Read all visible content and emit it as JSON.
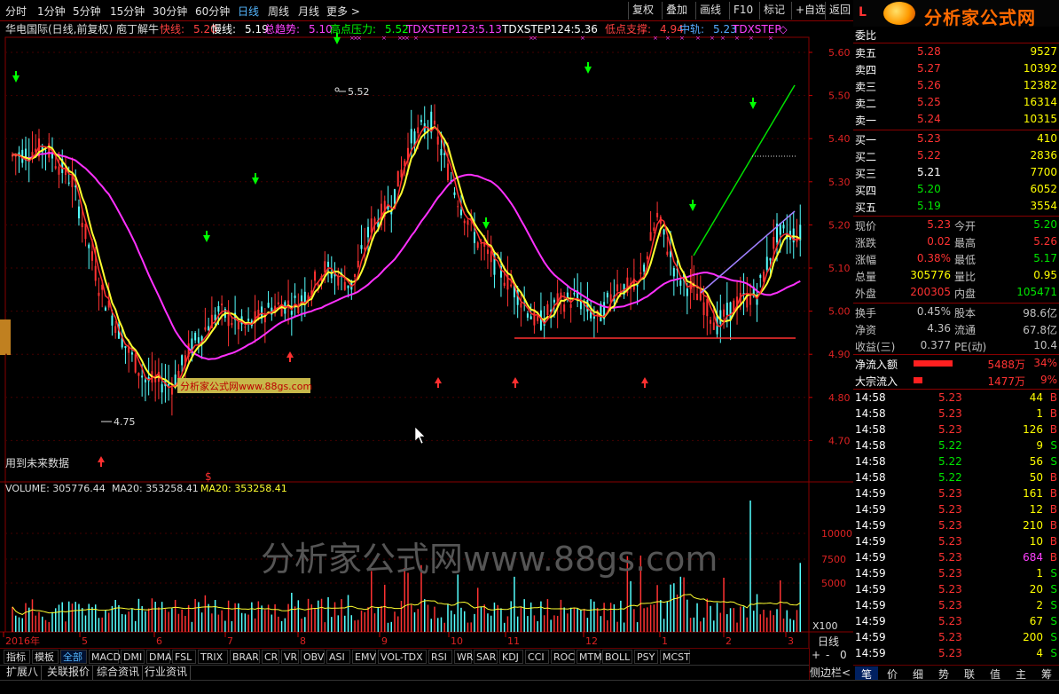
{
  "toolbar": {
    "timeframes": [
      "分时",
      "1分钟",
      "5分钟",
      "15分钟",
      "30分钟",
      "60分钟",
      "日线",
      "周线",
      "月线",
      "更多 >"
    ],
    "active_index": 6,
    "right_buttons": [
      "复权",
      "叠加",
      "画线",
      "F10",
      "标记",
      "+自选",
      "返回"
    ]
  },
  "logo": {
    "letter": "L",
    "name": "分析家公式网",
    "url": "www.88gs.com"
  },
  "chart": {
    "header_title": "华电国际(日线,前复权) 庖丁解牛",
    "indicators": [
      {
        "label": "快线:",
        "value": "5.20",
        "color": "#ff4040"
      },
      {
        "label": "慢线:",
        "value": "5.19",
        "color": "#ffffff"
      },
      {
        "label": "总趋势:",
        "value": "5.10",
        "color": "#ff40ff"
      },
      {
        "label": "高点压力:",
        "value": "5.52",
        "color": "#00ff00"
      },
      {
        "label": "TDXSTEP123:",
        "value": "5.13",
        "color": "#ff40ff"
      },
      {
        "label": "TDXSTEP124:",
        "value": "5.36",
        "color": "#ffffff"
      },
      {
        "label": "低点支撑:",
        "value": "4.94",
        "color": "#ff4040"
      },
      {
        "label": "中轨:",
        "value": "5.23",
        "color": "#55aaff"
      },
      {
        "label": "TDXSTEP",
        "value": "◇",
        "color": "#ff40ff"
      }
    ],
    "price_ticks": [
      "5.60",
      "5.50",
      "5.40",
      "5.30",
      "5.20",
      "5.10",
      "5.00",
      "4.90",
      "4.80",
      "4.70"
    ],
    "high_label": "5.52",
    "low_label": "4.75",
    "future_note": "用到未来数据",
    "watermark_small": "分析家公式网www.88gs.com",
    "volume_header": {
      "vol": "VOLUME: 305776.44",
      "ma1": "MA20: 353258.41",
      "ma2": "MA20: 353258.41"
    },
    "volume_ticks": [
      "10000",
      "7500",
      "5000"
    ],
    "volume_unit": "X100",
    "watermark_big": "分析家公式网www.88gs.com",
    "x_labels": [
      "2016年",
      "5",
      "6",
      "7",
      "8",
      "9",
      "10",
      "11",
      "12",
      "1",
      "2",
      "3"
    ],
    "period_label": "日线",
    "dollar_mark": "$"
  },
  "bottom_tabs": [
    "指标",
    "模板",
    "全部",
    "MACD",
    "DMI",
    "DMA",
    "FSL",
    "TRIX",
    "BRAR",
    "CR",
    "VR",
    "OBV",
    "ASI",
    "EMV",
    "VOL-TDX",
    "RSI",
    "WR",
    "SAR",
    "KDJ",
    "CCI",
    "ROC",
    "MTM",
    "BOLL",
    "PSY",
    "MCST"
  ],
  "bottom_selected": 2,
  "bottom2_tabs": [
    "扩展八",
    "关联报价",
    "综合资讯",
    "行业资讯"
  ],
  "right_controls": [
    "+",
    "-",
    "0",
    "侧边栏<"
  ],
  "quote": {
    "header": "委比",
    "asks": [
      {
        "label": "卖五",
        "price": "5.28",
        "vol": "9527"
      },
      {
        "label": "卖四",
        "price": "5.27",
        "vol": "10392"
      },
      {
        "label": "卖三",
        "price": "5.26",
        "vol": "12382"
      },
      {
        "label": "卖二",
        "price": "5.25",
        "vol": "16314"
      },
      {
        "label": "卖一",
        "price": "5.24",
        "vol": "10315"
      }
    ],
    "bids": [
      {
        "label": "买一",
        "price": "5.23",
        "vol": "410",
        "pc": "red"
      },
      {
        "label": "买二",
        "price": "5.22",
        "vol": "2836",
        "pc": "red"
      },
      {
        "label": "买三",
        "price": "5.21",
        "vol": "7700",
        "pc": "wht"
      },
      {
        "label": "买四",
        "price": "5.20",
        "vol": "6052",
        "pc": "grn"
      },
      {
        "label": "买五",
        "price": "5.19",
        "vol": "3554",
        "pc": "grn"
      }
    ],
    "stats": [
      {
        "l1": "现价",
        "v1": "5.23",
        "c1": "red",
        "l2": "今开",
        "v2": "5.20",
        "c2": "grn"
      },
      {
        "l1": "涨跌",
        "v1": "0.02",
        "c1": "red",
        "l2": "最高",
        "v2": "5.26",
        "c2": "red"
      },
      {
        "l1": "涨幅",
        "v1": "0.38%",
        "c1": "red",
        "l2": "最低",
        "v2": "5.17",
        "c2": "grn"
      },
      {
        "l1": "总量",
        "v1": "305776",
        "c1": "yel",
        "l2": "量比",
        "v2": "0.95",
        "c2": "yel"
      },
      {
        "l1": "外盘",
        "v1": "200305",
        "c1": "red",
        "l2": "内盘",
        "v2": "105471",
        "c2": "grn"
      }
    ],
    "stats2": [
      {
        "l1": "换手",
        "v1": "0.45%",
        "l2": "股本",
        "v2": "98.6亿"
      },
      {
        "l1": "净资",
        "v1": "4.36",
        "l2": "流通",
        "v2": "67.8亿"
      },
      {
        "l1": "收益(三)",
        "v1": "0.377",
        "l2": "PE(动)",
        "v2": "10.4"
      }
    ],
    "flows": [
      {
        "label": "净流入额",
        "value": "5488万",
        "pct": "34%"
      },
      {
        "label": "大宗流入",
        "value": "1477万",
        "pct": "9%"
      }
    ],
    "ticks": [
      [
        "14:58",
        "5.23",
        "44",
        "B"
      ],
      [
        "14:58",
        "5.23",
        "1",
        "B"
      ],
      [
        "14:58",
        "5.23",
        "126",
        "B"
      ],
      [
        "14:58",
        "5.22",
        "9",
        "S"
      ],
      [
        "14:58",
        "5.22",
        "56",
        "S"
      ],
      [
        "14:58",
        "5.22",
        "50",
        "B"
      ],
      [
        "14:59",
        "5.23",
        "161",
        "B"
      ],
      [
        "14:59",
        "5.23",
        "12",
        "B"
      ],
      [
        "14:59",
        "5.23",
        "210",
        "B"
      ],
      [
        "14:59",
        "5.23",
        "10",
        "B"
      ],
      [
        "14:59",
        "5.23",
        "684",
        "B"
      ],
      [
        "14:59",
        "5.23",
        "1",
        "S"
      ],
      [
        "14:59",
        "5.23",
        "20",
        "S"
      ],
      [
        "14:59",
        "5.23",
        "2",
        "S"
      ],
      [
        "14:59",
        "5.23",
        "67",
        "S"
      ],
      [
        "14:59",
        "5.23",
        "200",
        "S"
      ],
      [
        "14:59",
        "5.23",
        "4",
        "S"
      ]
    ],
    "tabs": [
      "笔",
      "价",
      "细",
      "势",
      "联",
      "值",
      "主",
      "筹"
    ]
  }
}
